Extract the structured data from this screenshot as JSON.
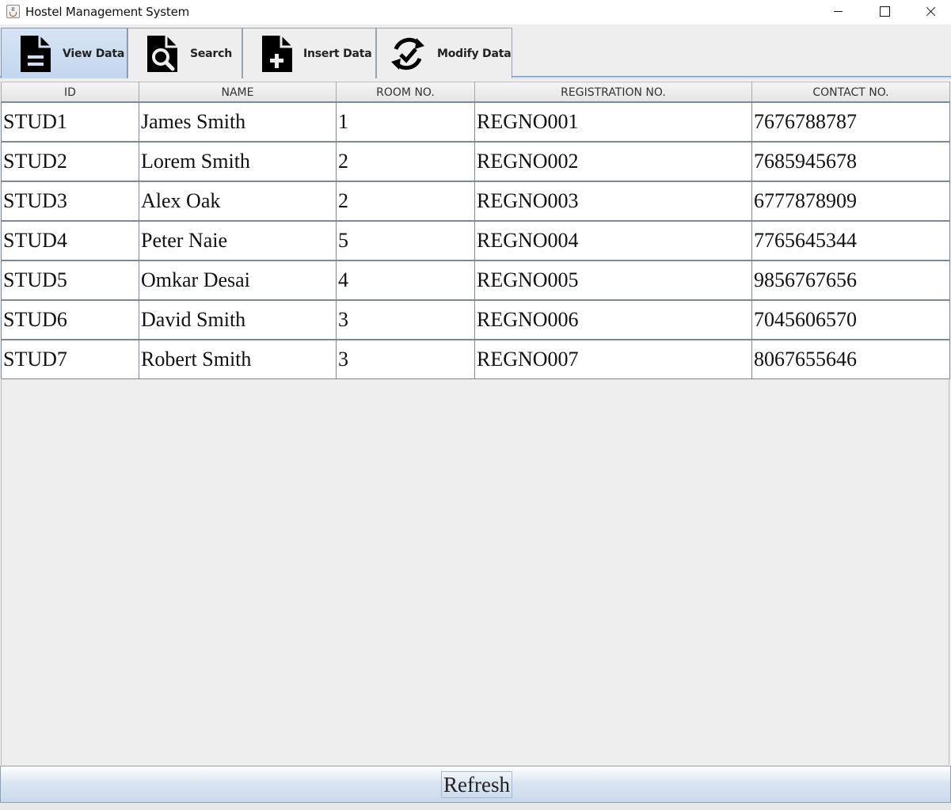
{
  "window": {
    "title": "Hostel Management System",
    "icon": "java-cup-icon"
  },
  "tabs": [
    {
      "label": "View Data",
      "icon": "document-icon",
      "active": true
    },
    {
      "label": "Search",
      "icon": "document-search-icon",
      "active": false
    },
    {
      "label": "Insert Data",
      "icon": "document-add-icon",
      "active": false
    },
    {
      "label": "Modify Data",
      "icon": "refresh-check-icon",
      "active": false
    }
  ],
  "table": {
    "columns": [
      "ID",
      "NAME",
      "ROOM NO.",
      "REGISTRATION NO.",
      "CONTACT NO."
    ],
    "rows": [
      [
        "STUD1",
        "James Smith",
        "1",
        "REGNO001",
        "7676788787"
      ],
      [
        "STUD2",
        "Lorem Smith",
        "2",
        "REGNO002",
        "7685945678"
      ],
      [
        "STUD3",
        "Alex Oak",
        "2",
        "REGNO003",
        "6777878909"
      ],
      [
        "STUD4",
        "Peter Naie",
        "5",
        "REGNO004",
        "7765645344"
      ],
      [
        "STUD5",
        "Omkar Desai",
        "4",
        "REGNO005",
        "9856767656"
      ],
      [
        "STUD6",
        "David Smith",
        "3",
        "REGNO006",
        "7045606570"
      ],
      [
        "STUD7",
        "Robert Smith",
        "3",
        "REGNO007",
        "8067655646"
      ]
    ]
  },
  "footer": {
    "refresh_label": "Refresh"
  },
  "colors": {
    "active_tab": "#c3d6ee",
    "window_bg": "#eeeeee",
    "grid_line": "#7c8797"
  }
}
